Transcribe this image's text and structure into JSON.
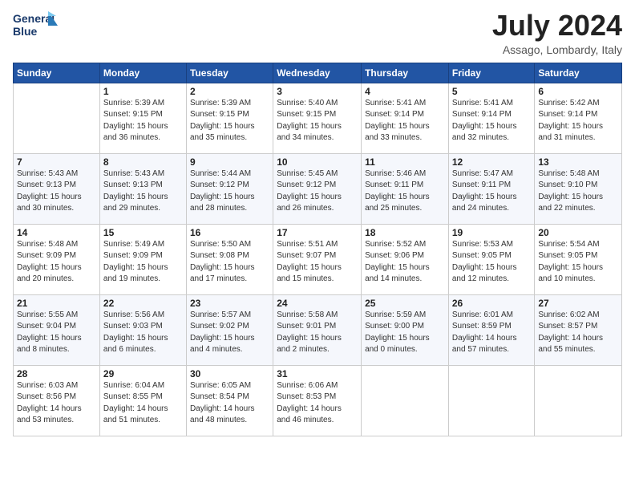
{
  "header": {
    "logo_line1": "General",
    "logo_line2": "Blue",
    "month_year": "July 2024",
    "location": "Assago, Lombardy, Italy"
  },
  "days_of_week": [
    "Sunday",
    "Monday",
    "Tuesday",
    "Wednesday",
    "Thursday",
    "Friday",
    "Saturday"
  ],
  "weeks": [
    [
      {
        "day": "",
        "info": ""
      },
      {
        "day": "1",
        "info": "Sunrise: 5:39 AM\nSunset: 9:15 PM\nDaylight: 15 hours\nand 36 minutes."
      },
      {
        "day": "2",
        "info": "Sunrise: 5:39 AM\nSunset: 9:15 PM\nDaylight: 15 hours\nand 35 minutes."
      },
      {
        "day": "3",
        "info": "Sunrise: 5:40 AM\nSunset: 9:15 PM\nDaylight: 15 hours\nand 34 minutes."
      },
      {
        "day": "4",
        "info": "Sunrise: 5:41 AM\nSunset: 9:14 PM\nDaylight: 15 hours\nand 33 minutes."
      },
      {
        "day": "5",
        "info": "Sunrise: 5:41 AM\nSunset: 9:14 PM\nDaylight: 15 hours\nand 32 minutes."
      },
      {
        "day": "6",
        "info": "Sunrise: 5:42 AM\nSunset: 9:14 PM\nDaylight: 15 hours\nand 31 minutes."
      }
    ],
    [
      {
        "day": "7",
        "info": "Sunrise: 5:43 AM\nSunset: 9:13 PM\nDaylight: 15 hours\nand 30 minutes."
      },
      {
        "day": "8",
        "info": "Sunrise: 5:43 AM\nSunset: 9:13 PM\nDaylight: 15 hours\nand 29 minutes."
      },
      {
        "day": "9",
        "info": "Sunrise: 5:44 AM\nSunset: 9:12 PM\nDaylight: 15 hours\nand 28 minutes."
      },
      {
        "day": "10",
        "info": "Sunrise: 5:45 AM\nSunset: 9:12 PM\nDaylight: 15 hours\nand 26 minutes."
      },
      {
        "day": "11",
        "info": "Sunrise: 5:46 AM\nSunset: 9:11 PM\nDaylight: 15 hours\nand 25 minutes."
      },
      {
        "day": "12",
        "info": "Sunrise: 5:47 AM\nSunset: 9:11 PM\nDaylight: 15 hours\nand 24 minutes."
      },
      {
        "day": "13",
        "info": "Sunrise: 5:48 AM\nSunset: 9:10 PM\nDaylight: 15 hours\nand 22 minutes."
      }
    ],
    [
      {
        "day": "14",
        "info": "Sunrise: 5:48 AM\nSunset: 9:09 PM\nDaylight: 15 hours\nand 20 minutes."
      },
      {
        "day": "15",
        "info": "Sunrise: 5:49 AM\nSunset: 9:09 PM\nDaylight: 15 hours\nand 19 minutes."
      },
      {
        "day": "16",
        "info": "Sunrise: 5:50 AM\nSunset: 9:08 PM\nDaylight: 15 hours\nand 17 minutes."
      },
      {
        "day": "17",
        "info": "Sunrise: 5:51 AM\nSunset: 9:07 PM\nDaylight: 15 hours\nand 15 minutes."
      },
      {
        "day": "18",
        "info": "Sunrise: 5:52 AM\nSunset: 9:06 PM\nDaylight: 15 hours\nand 14 minutes."
      },
      {
        "day": "19",
        "info": "Sunrise: 5:53 AM\nSunset: 9:05 PM\nDaylight: 15 hours\nand 12 minutes."
      },
      {
        "day": "20",
        "info": "Sunrise: 5:54 AM\nSunset: 9:05 PM\nDaylight: 15 hours\nand 10 minutes."
      }
    ],
    [
      {
        "day": "21",
        "info": "Sunrise: 5:55 AM\nSunset: 9:04 PM\nDaylight: 15 hours\nand 8 minutes."
      },
      {
        "day": "22",
        "info": "Sunrise: 5:56 AM\nSunset: 9:03 PM\nDaylight: 15 hours\nand 6 minutes."
      },
      {
        "day": "23",
        "info": "Sunrise: 5:57 AM\nSunset: 9:02 PM\nDaylight: 15 hours\nand 4 minutes."
      },
      {
        "day": "24",
        "info": "Sunrise: 5:58 AM\nSunset: 9:01 PM\nDaylight: 15 hours\nand 2 minutes."
      },
      {
        "day": "25",
        "info": "Sunrise: 5:59 AM\nSunset: 9:00 PM\nDaylight: 15 hours\nand 0 minutes."
      },
      {
        "day": "26",
        "info": "Sunrise: 6:01 AM\nSunset: 8:59 PM\nDaylight: 14 hours\nand 57 minutes."
      },
      {
        "day": "27",
        "info": "Sunrise: 6:02 AM\nSunset: 8:57 PM\nDaylight: 14 hours\nand 55 minutes."
      }
    ],
    [
      {
        "day": "28",
        "info": "Sunrise: 6:03 AM\nSunset: 8:56 PM\nDaylight: 14 hours\nand 53 minutes."
      },
      {
        "day": "29",
        "info": "Sunrise: 6:04 AM\nSunset: 8:55 PM\nDaylight: 14 hours\nand 51 minutes."
      },
      {
        "day": "30",
        "info": "Sunrise: 6:05 AM\nSunset: 8:54 PM\nDaylight: 14 hours\nand 48 minutes."
      },
      {
        "day": "31",
        "info": "Sunrise: 6:06 AM\nSunset: 8:53 PM\nDaylight: 14 hours\nand 46 minutes."
      },
      {
        "day": "",
        "info": ""
      },
      {
        "day": "",
        "info": ""
      },
      {
        "day": "",
        "info": ""
      }
    ]
  ]
}
